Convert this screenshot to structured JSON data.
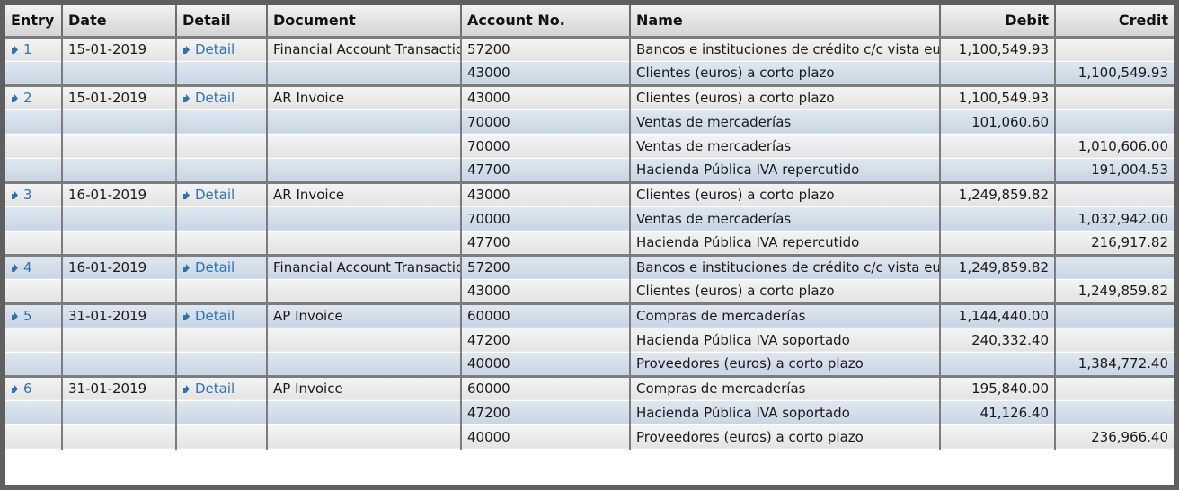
{
  "headers": {
    "entry": "Entry",
    "date": "Date",
    "detail": "Detail",
    "document": "Document",
    "account": "Account No.",
    "name": "Name",
    "debit": "Debit",
    "credit": "Credit"
  },
  "link_icon": "arrow-link-icon",
  "rows": [
    {
      "entry": "1",
      "date": "15-01-2019",
      "detail": "Detail",
      "document": "Financial Account Transaction",
      "account": "57200",
      "name": "Bancos e instituciones de crédito c/c vista euros",
      "debit": "1,100,549.93",
      "credit": ""
    },
    {
      "entry": "",
      "date": "",
      "detail": "",
      "document": "",
      "account": "43000",
      "name": "Clientes (euros) a corto plazo",
      "debit": "",
      "credit": "1,100,549.93"
    },
    {
      "entry": "2",
      "date": "15-01-2019",
      "detail": "Detail",
      "document": "AR Invoice",
      "account": "43000",
      "name": "Clientes (euros) a corto plazo",
      "debit": "1,100,549.93",
      "credit": ""
    },
    {
      "entry": "",
      "date": "",
      "detail": "",
      "document": "",
      "account": "70000",
      "name": "Ventas de mercaderías",
      "debit": "101,060.60",
      "credit": ""
    },
    {
      "entry": "",
      "date": "",
      "detail": "",
      "document": "",
      "account": "70000",
      "name": "Ventas de mercaderías",
      "debit": "",
      "credit": "1,010,606.00"
    },
    {
      "entry": "",
      "date": "",
      "detail": "",
      "document": "",
      "account": "47700",
      "name": "Hacienda Pública IVA repercutido",
      "debit": "",
      "credit": "191,004.53"
    },
    {
      "entry": "3",
      "date": "16-01-2019",
      "detail": "Detail",
      "document": "AR Invoice",
      "account": "43000",
      "name": "Clientes (euros) a corto plazo",
      "debit": "1,249,859.82",
      "credit": ""
    },
    {
      "entry": "",
      "date": "",
      "detail": "",
      "document": "",
      "account": "70000",
      "name": "Ventas de mercaderías",
      "debit": "",
      "credit": "1,032,942.00"
    },
    {
      "entry": "",
      "date": "",
      "detail": "",
      "document": "",
      "account": "47700",
      "name": "Hacienda Pública IVA repercutido",
      "debit": "",
      "credit": "216,917.82"
    },
    {
      "entry": "4",
      "date": "16-01-2019",
      "detail": "Detail",
      "document": "Financial Account Transaction",
      "account": "57200",
      "name": "Bancos e instituciones de crédito c/c vista euros",
      "debit": "1,249,859.82",
      "credit": ""
    },
    {
      "entry": "",
      "date": "",
      "detail": "",
      "document": "",
      "account": "43000",
      "name": "Clientes (euros) a corto plazo",
      "debit": "",
      "credit": "1,249,859.82"
    },
    {
      "entry": "5",
      "date": "31-01-2019",
      "detail": "Detail",
      "document": "AP Invoice",
      "account": "60000",
      "name": "Compras de mercaderías",
      "debit": "1,144,440.00",
      "credit": ""
    },
    {
      "entry": "",
      "date": "",
      "detail": "",
      "document": "",
      "account": "47200",
      "name": "Hacienda Pública IVA soportado",
      "debit": "240,332.40",
      "credit": ""
    },
    {
      "entry": "",
      "date": "",
      "detail": "",
      "document": "",
      "account": "40000",
      "name": "Proveedores (euros) a corto plazo",
      "debit": "",
      "credit": "1,384,772.40"
    },
    {
      "entry": "6",
      "date": "31-01-2019",
      "detail": "Detail",
      "document": "AP Invoice",
      "account": "60000",
      "name": "Compras de mercaderías",
      "debit": "195,840.00",
      "credit": ""
    },
    {
      "entry": "",
      "date": "",
      "detail": "",
      "document": "",
      "account": "47200",
      "name": "Hacienda Pública IVA soportado",
      "debit": "41,126.40",
      "credit": ""
    },
    {
      "entry": "",
      "date": "",
      "detail": "",
      "document": "",
      "account": "40000",
      "name": "Proveedores (euros) a corto plazo",
      "debit": "",
      "credit": "236,966.40"
    }
  ]
}
